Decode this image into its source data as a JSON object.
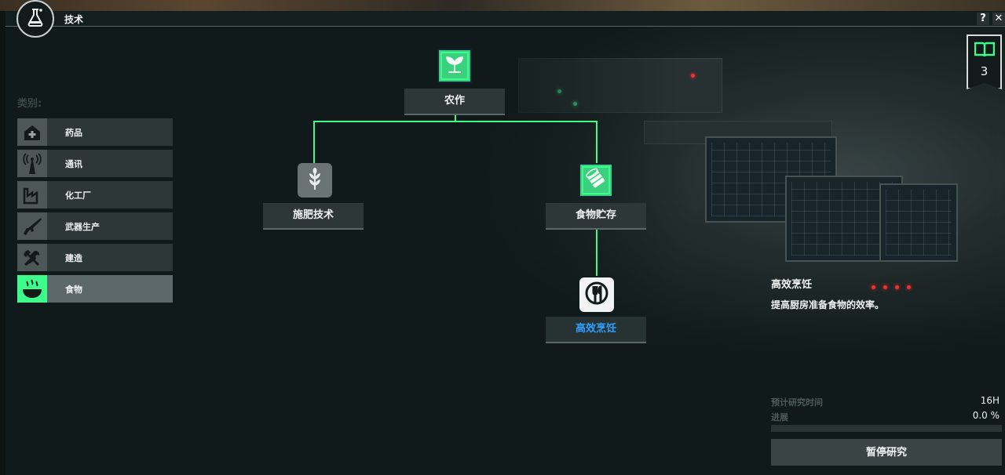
{
  "window": {
    "title": "技术"
  },
  "titlebar": {
    "help_label": "?",
    "close_label": "✕"
  },
  "research_queue": {
    "count": "3"
  },
  "categories": {
    "title": "类别:",
    "items": [
      {
        "label": "药品",
        "icon": "hospital-icon"
      },
      {
        "label": "通讯",
        "icon": "antenna-icon"
      },
      {
        "label": "化工厂",
        "icon": "factory-icon"
      },
      {
        "label": "武器生产",
        "icon": "rifle-icon"
      },
      {
        "label": "建造",
        "icon": "tools-icon"
      },
      {
        "label": "食物",
        "icon": "cooking-pot-icon",
        "selected": true
      }
    ]
  },
  "tree": {
    "nodes": [
      {
        "label": "农作",
        "icon": "sprout-icon",
        "state": "researched"
      },
      {
        "label": "施肥技术",
        "icon": "wheat-icon",
        "state": "locked"
      },
      {
        "label": "食物贮存",
        "icon": "can-icon",
        "state": "researched"
      },
      {
        "label": "高效烹饪",
        "icon": "plate-cutlery-icon",
        "state": "researching"
      }
    ]
  },
  "detail": {
    "title": "高效烹饪",
    "description": "提高厨房准备食物的效率。",
    "time_label": "预计研究时间",
    "time_value": "16H",
    "progress_label": "进展",
    "progress_value": "0.0 %",
    "progress_fraction": 0.0,
    "pause_button": "暂停研究"
  },
  "colors": {
    "accent": "#3dfc8c",
    "active_label": "#2ea0ff"
  }
}
